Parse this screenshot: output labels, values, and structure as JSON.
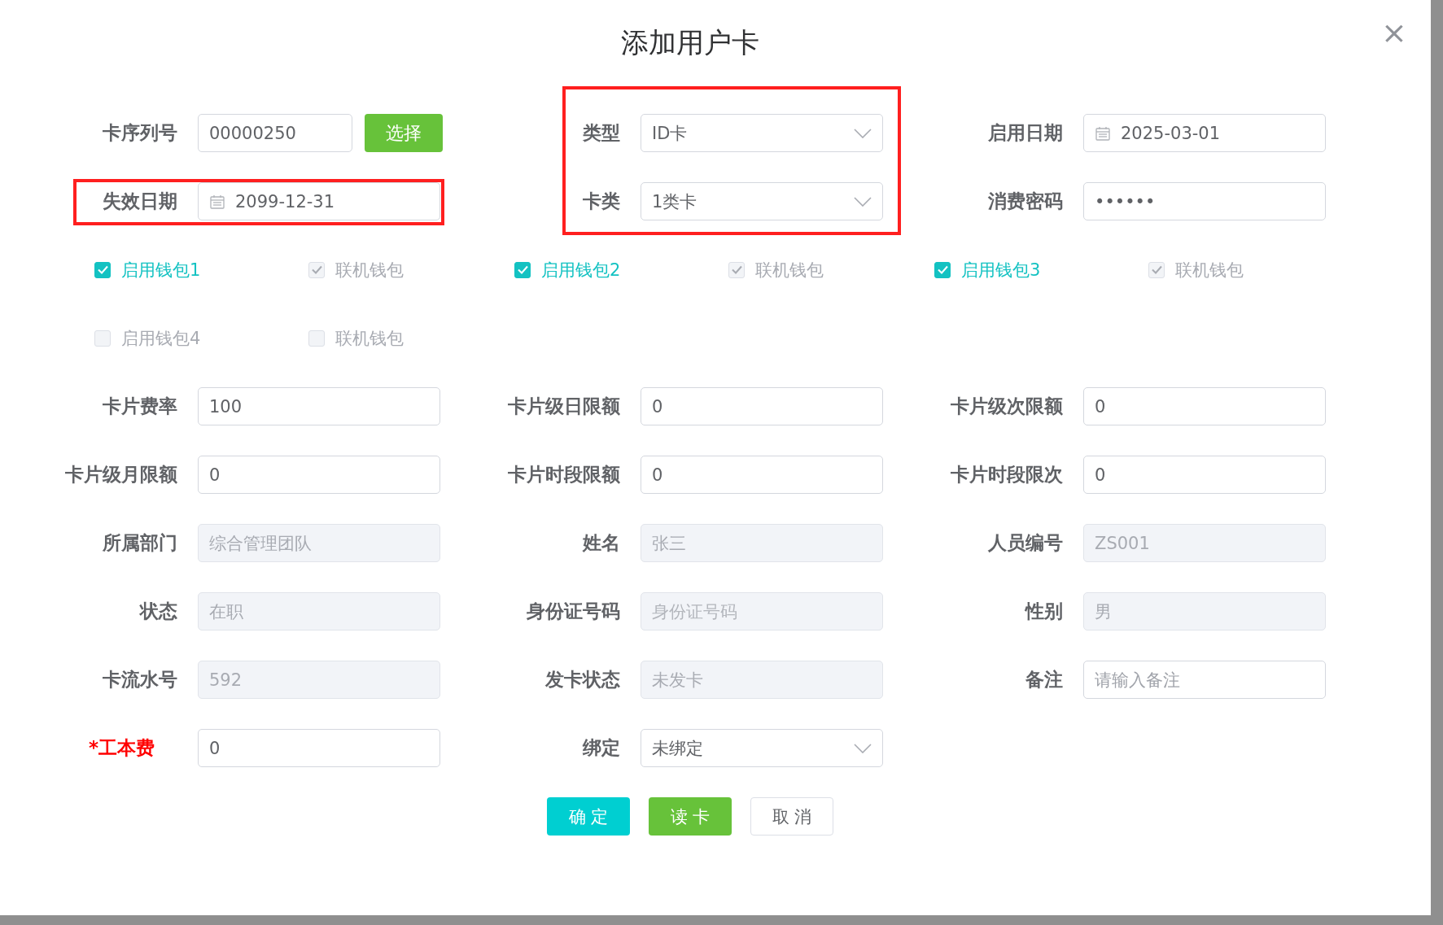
{
  "dialog": {
    "title": "添加用户卡",
    "close": "×",
    "top_fields": [
      {
        "label": "卡序列号",
        "kind": "text",
        "value": "00000250",
        "button": "选择"
      },
      {
        "label": "类型",
        "kind": "select",
        "value": "ID卡"
      },
      {
        "label": "启用日期",
        "kind": "date",
        "value": "2025-03-01"
      },
      {
        "label": "失效日期",
        "kind": "date",
        "value": "2099-12-31"
      },
      {
        "label": "卡类",
        "kind": "select",
        "value": "1类卡"
      },
      {
        "label": "消费密码",
        "kind": "text",
        "value": "••••••"
      }
    ],
    "wallets": [
      {
        "label": "启用钱包1",
        "checked": true,
        "disabled": false
      },
      {
        "label": "联机钱包",
        "checked": true,
        "disabled": true
      },
      {
        "label": "启用钱包2",
        "checked": true,
        "disabled": false
      },
      {
        "label": "联机钱包",
        "checked": true,
        "disabled": true
      },
      {
        "label": "启用钱包3",
        "checked": true,
        "disabled": false
      },
      {
        "label": "联机钱包",
        "checked": true,
        "disabled": true
      },
      {
        "label": "启用钱包4",
        "checked": false,
        "disabled": true
      },
      {
        "label": "联机钱包",
        "checked": false,
        "disabled": true
      }
    ],
    "fields": [
      {
        "label": "卡片费率",
        "kind": "text",
        "value": "100",
        "disabled": false
      },
      {
        "label": "卡片级日限额",
        "kind": "text",
        "value": "0",
        "disabled": false
      },
      {
        "label": "卡片级次限额",
        "kind": "text",
        "value": "0",
        "disabled": false
      },
      {
        "label": "卡片级月限额",
        "kind": "text",
        "value": "0",
        "disabled": false
      },
      {
        "label": "卡片时段限额",
        "kind": "text",
        "value": "0",
        "disabled": false
      },
      {
        "label": "卡片时段限次",
        "kind": "text",
        "value": "0",
        "disabled": false
      },
      {
        "label": "所属部门",
        "kind": "text",
        "value": "综合管理团队",
        "disabled": true
      },
      {
        "label": "姓名",
        "kind": "text",
        "value": "张三",
        "disabled": true
      },
      {
        "label": "人员编号",
        "kind": "text",
        "value": "ZS001",
        "disabled": true
      },
      {
        "label": "状态",
        "kind": "text",
        "value": "在职",
        "disabled": true
      },
      {
        "label": "身份证号码",
        "kind": "text",
        "placeholder": "身份证号码",
        "disabled": true
      },
      {
        "label": "性别",
        "kind": "text",
        "value": "男",
        "disabled": true
      },
      {
        "label": "卡流水号",
        "kind": "text",
        "value": "592",
        "disabled": true
      },
      {
        "label": "发卡状态",
        "kind": "text",
        "value": "未发卡",
        "disabled": true
      },
      {
        "label": "备注",
        "kind": "text",
        "placeholder": "请输入备注",
        "disabled": false
      },
      {
        "label": "*工本费",
        "kind": "text",
        "value": "0",
        "disabled": false,
        "required": true
      },
      {
        "label": "绑定",
        "kind": "select",
        "value": "未绑定",
        "disabled": false
      }
    ],
    "buttons": [
      {
        "label": "确 定",
        "kind": "primary"
      },
      {
        "label": "读 卡",
        "kind": "success"
      },
      {
        "label": "取 消",
        "kind": "plain"
      }
    ],
    "highlights": [
      {
        "color": "#ff1f1f"
      },
      {
        "color": "#ff1f1f"
      }
    ]
  }
}
